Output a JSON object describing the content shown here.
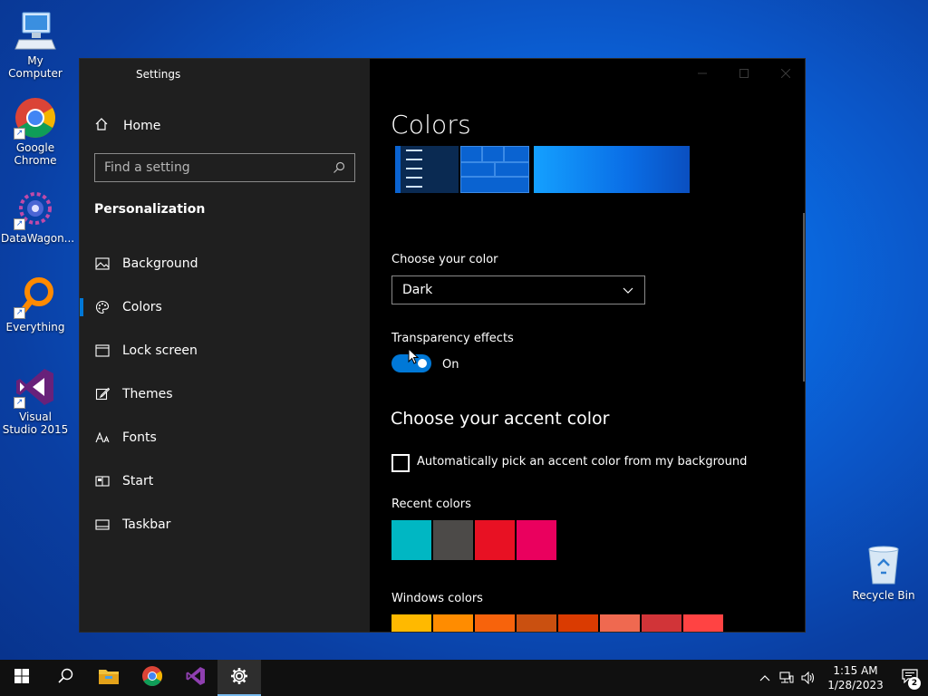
{
  "desktop": {
    "icons": [
      {
        "label": "My Computer",
        "icon": "computer-icon"
      },
      {
        "label": "Google Chrome",
        "icon": "chrome-icon"
      },
      {
        "label": "DataWagon...",
        "icon": "datawagon-icon"
      },
      {
        "label": "Everything",
        "icon": "everything-search-icon"
      },
      {
        "label": "Visual Studio 2015",
        "icon": "visual-studio-icon"
      }
    ],
    "recycle_bin": {
      "label": "Recycle Bin",
      "icon": "recycle-bin-icon"
    }
  },
  "window": {
    "title": "Settings",
    "sidebar": {
      "home_label": "Home",
      "search_placeholder": "Find a setting",
      "section_heading": "Personalization",
      "items": [
        {
          "label": "Background",
          "icon": "picture-icon"
        },
        {
          "label": "Colors",
          "icon": "palette-icon",
          "active": true
        },
        {
          "label": "Lock screen",
          "icon": "lock-screen-icon"
        },
        {
          "label": "Themes",
          "icon": "brush-icon"
        },
        {
          "label": "Fonts",
          "icon": "font-icon"
        },
        {
          "label": "Start",
          "icon": "start-layout-icon"
        },
        {
          "label": "Taskbar",
          "icon": "taskbar-icon"
        }
      ]
    },
    "content": {
      "page_title": "Colors",
      "choose_color_label": "Choose your color",
      "choose_color_value": "Dark",
      "transparency_label": "Transparency effects",
      "transparency_state": "On",
      "accent_heading": "Choose your accent color",
      "auto_pick_label": "Automatically pick an accent color from my background",
      "recent_colors_label": "Recent colors",
      "recent_colors": [
        "#00b7c3",
        "#4c4a48",
        "#e81123",
        "#ea005e"
      ],
      "windows_colors_label": "Windows colors",
      "windows_colors": [
        "#ffb900",
        "#ff8c00",
        "#f7630c",
        "#ca5010",
        "#da3b01",
        "#ef6950",
        "#d13438",
        "#ff4343"
      ]
    }
  },
  "taskbar": {
    "apps": [
      "start-icon",
      "search-icon",
      "file-explorer-icon",
      "chrome-icon",
      "visual-studio-icon",
      "settings-gear-icon"
    ],
    "time": "1:15 AM",
    "date": "1/28/2023",
    "notification_count": "2"
  },
  "colors": {
    "accent": "#0078d7",
    "sidebar_bg": "#1f1f1f",
    "content_bg": "#000000"
  }
}
